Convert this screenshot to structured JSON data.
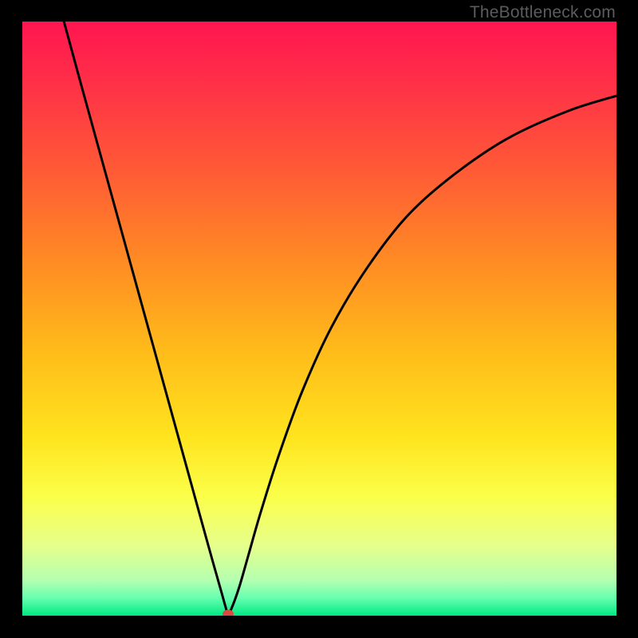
{
  "watermark": {
    "text": "TheBottleneck.com"
  },
  "chart_data": {
    "type": "line",
    "title": "",
    "xlabel": "",
    "ylabel": "",
    "xlim": [
      0,
      100
    ],
    "ylim": [
      0,
      100
    ],
    "grid": false,
    "legend": false,
    "gradient_stops": [
      {
        "offset": 0.0,
        "color": "#ff1550"
      },
      {
        "offset": 0.1,
        "color": "#ff2f48"
      },
      {
        "offset": 0.25,
        "color": "#ff5a36"
      },
      {
        "offset": 0.4,
        "color": "#ff8a24"
      },
      {
        "offset": 0.55,
        "color": "#ffba1a"
      },
      {
        "offset": 0.7,
        "color": "#ffe41e"
      },
      {
        "offset": 0.8,
        "color": "#fbff4a"
      },
      {
        "offset": 0.88,
        "color": "#e7ff8a"
      },
      {
        "offset": 0.94,
        "color": "#b5ffb0"
      },
      {
        "offset": 0.97,
        "color": "#68ffb0"
      },
      {
        "offset": 1.0,
        "color": "#00e882"
      }
    ],
    "series": [
      {
        "name": "bottleneck-curve",
        "x": [
          7.0,
          10.0,
          14.0,
          18.0,
          22.0,
          26.0,
          30.0,
          32.0,
          33.5,
          34.2,
          34.6,
          35.2,
          36.5,
          38.0,
          40.0,
          43.0,
          47.0,
          52.0,
          58.0,
          65.0,
          73.0,
          82.0,
          92.0,
          100.0
        ],
        "y": [
          100.0,
          89.0,
          74.5,
          60.0,
          45.5,
          31.0,
          16.5,
          9.3,
          4.0,
          1.5,
          0.3,
          1.2,
          4.8,
          10.0,
          17.0,
          26.5,
          37.5,
          48.5,
          58.5,
          67.5,
          74.5,
          80.5,
          85.0,
          87.5
        ]
      }
    ],
    "marker": {
      "x": 34.6,
      "y": 0.3,
      "color": "#d94b3a",
      "rx": 7,
      "ry": 5.5
    }
  }
}
